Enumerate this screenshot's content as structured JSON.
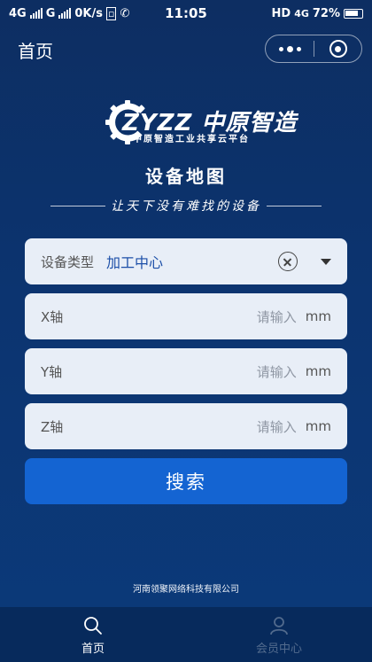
{
  "status_bar": {
    "left_texts": [
      "4G",
      "G",
      "0K/s"
    ],
    "time": "11:05",
    "network": "HD",
    "network2": "4G",
    "battery": "72%"
  },
  "nav": {
    "title": "首页"
  },
  "logo": {
    "brand": "ZYZZ 中原智造",
    "subtitle": "中原智造工业共享云平台"
  },
  "page": {
    "heading": "设备地图",
    "slogan": "让天下没有难找的设备"
  },
  "form": {
    "device_type": {
      "label": "设备类型",
      "value": "加工中心"
    },
    "x": {
      "label": "X轴",
      "placeholder": "请输入",
      "unit": "mm"
    },
    "y": {
      "label": "Y轴",
      "placeholder": "请输入",
      "unit": "mm"
    },
    "z": {
      "label": "Z轴",
      "placeholder": "请输入",
      "unit": "mm"
    },
    "search_label": "搜索"
  },
  "footer": {
    "company": "河南领聚网络科技有限公司"
  },
  "tabs": [
    {
      "label": "首页",
      "icon": "search-icon",
      "active": true
    },
    {
      "label": "会员中心",
      "icon": "user-icon",
      "active": false
    }
  ],
  "colors": {
    "background": "#0c3470",
    "accent": "#1464d2",
    "tabbar": "#072a5c",
    "field": "#e8eef7"
  }
}
